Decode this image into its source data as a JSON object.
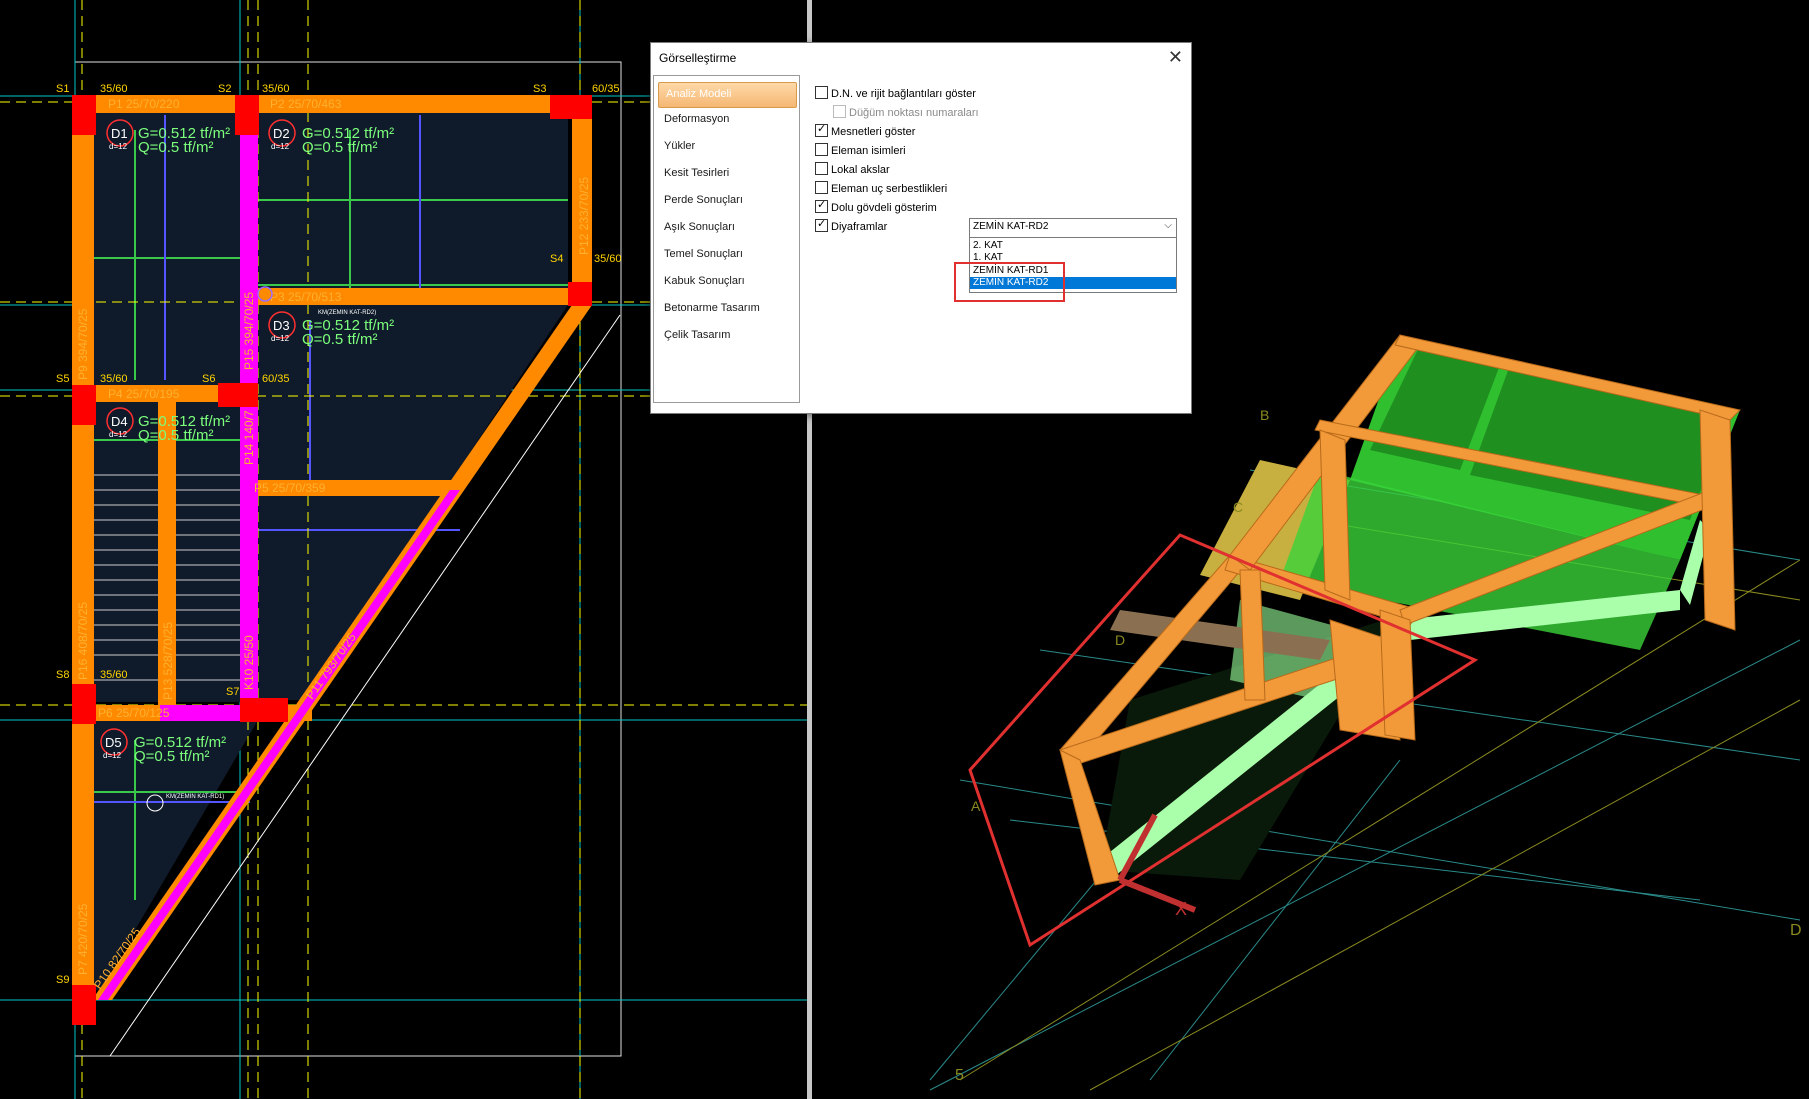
{
  "plan": {
    "columns": [
      "S1",
      "S2",
      "S3",
      "S4",
      "S5",
      "S6",
      "S7",
      "S8",
      "S9"
    ],
    "column_sizes": [
      "35/60",
      "35/60",
      "60/35",
      "35/60",
      "35/60",
      "60/35",
      "35/60"
    ],
    "beams": [
      "P1 25/70/220",
      "P2 25/70/463",
      "P3 25/70/513",
      "P4 25/70/195",
      "P5 25/70/359",
      "P6 25/70/125",
      "P7 420/70/25",
      "P9 394/70/25",
      "P12 233/70/25",
      "P13 528/70/25",
      "P14 140/7",
      "P15 394/70/25",
      "P16 408/70/25",
      "K10 25/50",
      "P11 793/70/25",
      "P10 82/70/25"
    ],
    "slabs": [
      {
        "id": "D1",
        "g": "G=0.512 tf/m²",
        "q": "Q=0.5 tf/m²",
        "d": "d=12"
      },
      {
        "id": "D2",
        "g": "G=0.512 tf/m²",
        "q": "Q=0.5 tf/m²",
        "d": "d=12"
      },
      {
        "id": "D3",
        "g": "G=0.512 tf/m²",
        "q": "Q=0.5 tf/m²",
        "d": "d=12"
      },
      {
        "id": "D4",
        "g": "G=0.512 tf/m²",
        "q": "Q=0.5 tf/m²",
        "d": "d=12"
      },
      {
        "id": "D5",
        "g": "G=0.512 tf/m²",
        "q": "Q=0.5 tf/m²",
        "d": "d=12"
      }
    ],
    "small_labels": [
      "KM(ZEMIN KAT-RD2)",
      "KM(ZEMIN KAT-RD1)"
    ],
    "colors": {
      "beam": "#ff8a00",
      "column": "#ff0000",
      "wall": "#ff00ff",
      "slab": "#0f1a2a",
      "grid": "#00c8c8",
      "axis": "#ffff00",
      "load": "#39c84a"
    }
  },
  "view3d": {
    "axis_labels": [
      "B",
      "C",
      "D",
      "A",
      "5",
      "D",
      "X"
    ],
    "colors": {
      "frame": "#f29a3a",
      "slab": "#39d339",
      "highlight": "#e03030"
    }
  },
  "dialog": {
    "title": "Görselleştirme",
    "close": "✕",
    "nav": [
      "Analiz Modeli",
      "Deformasyon",
      "Yükler",
      "Kesit Tesirleri",
      "Perde Sonuçları",
      "Aşık Sonuçları",
      "Temel Sonuçları",
      "Kabuk Sonuçları",
      "Betonarme Tasarım",
      "Çelik Tasarım"
    ],
    "active_nav": "Analiz Modeli",
    "options": [
      {
        "label": "D.N. ve rijit bağlantıları göster",
        "checked": false,
        "disabled": false
      },
      {
        "label": "Düğüm noktası numaraları",
        "checked": false,
        "disabled": true
      },
      {
        "label": "Mesnetleri göster",
        "checked": true,
        "disabled": false
      },
      {
        "label": "Eleman isimleri",
        "checked": false,
        "disabled": false
      },
      {
        "label": "Lokal akslar",
        "checked": false,
        "disabled": false
      },
      {
        "label": "Eleman uç serbestlikleri",
        "checked": false,
        "disabled": false
      },
      {
        "label": "Dolu gövdeli gösterim",
        "checked": true,
        "disabled": false
      },
      {
        "label": "Diyaframlar",
        "checked": true,
        "disabled": false
      }
    ],
    "diaphragm_selected": "ZEMİN KAT-RD2",
    "diaphragm_options": [
      "2. KAT",
      "1. KAT",
      "ZEMİN KAT-RD1",
      "ZEMİN KAT-RD2"
    ],
    "dropdown_arrow": "⌵"
  }
}
